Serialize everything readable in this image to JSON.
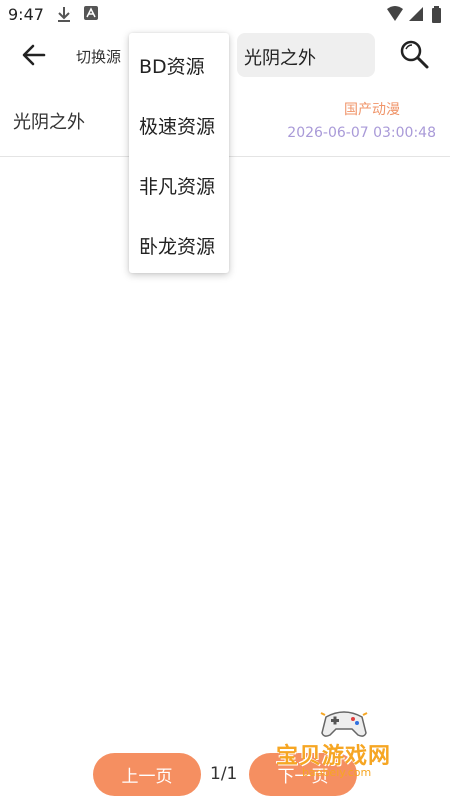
{
  "status_bar": {
    "time": "9:47"
  },
  "toolbar": {
    "switch_label": "切换源",
    "search_value": "光阴之外"
  },
  "result": {
    "title": "光阴之外",
    "category": "国产动漫",
    "time": "2026-06-07 03:00:48"
  },
  "dropdown": {
    "items": [
      "BD资源",
      "极速资源",
      "非凡资源",
      "卧龙资源"
    ]
  },
  "pager": {
    "prev": "上一页",
    "indicator": "1/1",
    "next": "下一页"
  },
  "watermark": {
    "text": "宝贝游戏网",
    "url": "baobeiy.com"
  },
  "colors": {
    "accent": "#f58f61",
    "tag": "#f0956a",
    "time": "#a99ad8"
  }
}
